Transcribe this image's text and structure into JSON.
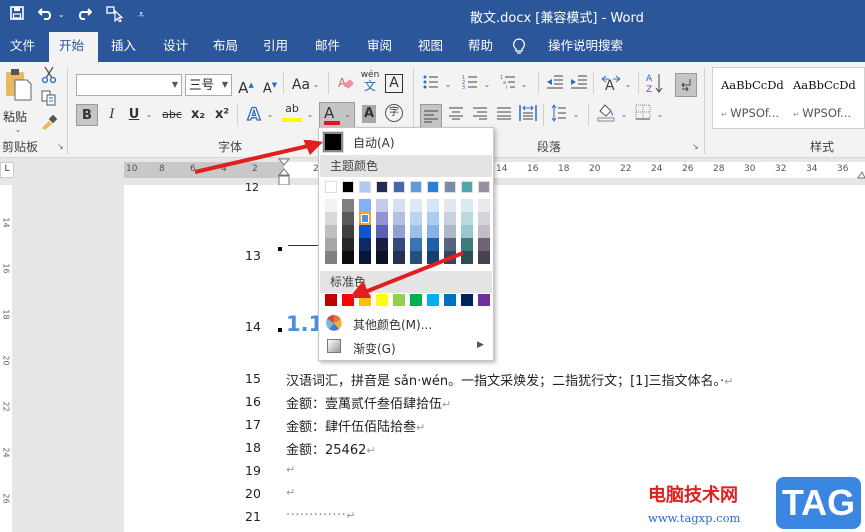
{
  "window": {
    "title": "散文.docx [兼容模式]  -  Word",
    "quick_access": {
      "save_icon": "💾",
      "undo_icon": "↶",
      "redo_icon": "↷",
      "touch_icon": "☞",
      "customize_icon": "⩡"
    }
  },
  "tabs": [
    {
      "label": "文件"
    },
    {
      "label": "开始",
      "active": true
    },
    {
      "label": "插入"
    },
    {
      "label": "设计"
    },
    {
      "label": "布局"
    },
    {
      "label": "引用"
    },
    {
      "label": "邮件"
    },
    {
      "label": "审阅"
    },
    {
      "label": "视图"
    },
    {
      "label": "帮助"
    },
    {
      "label": "操作说明搜索"
    }
  ],
  "ribbon": {
    "clipboard": {
      "paste_label": "粘贴",
      "group_label": "剪贴板"
    },
    "font": {
      "font_name": "",
      "font_size": "三号",
      "grow": "A",
      "shrink": "A",
      "case": "Aa",
      "phonetic_top": "wén",
      "phonetic_bottom": "文",
      "border_char": "A",
      "bold": "B",
      "italic": "I",
      "underline": "U",
      "strike": "abc",
      "subscript": "x₂",
      "superscript": "x²",
      "effects": "A",
      "highlight": "ab",
      "font_color": "A",
      "shade_char": "A",
      "enclose_char": "字",
      "group_label": "字体",
      "font_color_hex": "#e81123",
      "highlight_hex": "#ffff00"
    },
    "paragraph": {
      "group_label": "段落"
    },
    "styles": {
      "items": [
        {
          "preview": "AaBbCcDd",
          "name": "WPSOf..."
        },
        {
          "preview": "AaBbCcDd",
          "name": "WPSOf..."
        }
      ],
      "group_label": "样式"
    }
  },
  "ruler": {
    "left_numbers": [
      "10",
      "8",
      "6",
      "4",
      "2"
    ],
    "right_numbers": [
      "2",
      "14",
      "16",
      "18",
      "20",
      "22",
      "24",
      "26",
      "28",
      "30",
      "32",
      "34",
      "36"
    ],
    "vertical_numbers": [
      "14",
      "16",
      "18",
      "20",
      "22",
      "24",
      "26"
    ],
    "tab_selector": "L"
  },
  "document": {
    "lines": [
      {
        "num": "12",
        "text": ""
      },
      {
        "num": "13",
        "text": "—"
      },
      {
        "num": "14",
        "text": "1.1"
      },
      {
        "num": "15",
        "text": "汉语词汇，拼音是 sǎn·wén。一指文采焕发；二指犹行文；[1]三指文体名。·"
      },
      {
        "num": "16",
        "text": "金额：壹萬贰仟叁佰肆拾伍"
      },
      {
        "num": "17",
        "text": "金额：肆仟伍佰陆拾叁"
      },
      {
        "num": "18",
        "text": "金额：25462"
      },
      {
        "num": "19",
        "text": ""
      },
      {
        "num": "20",
        "text": ""
      },
      {
        "num": "21",
        "text": "·············"
      }
    ],
    "paragraph_mark": "↵"
  },
  "color_menu": {
    "automatic_label": "自动(A)",
    "theme_header": "主题颜色",
    "standard_header": "标准色",
    "more_colors_label": "其他颜色(M)...",
    "gradient_label": "渐变(G)",
    "theme_top_row": [
      "#ffffff",
      "#000000",
      "#aecbf4",
      "#232a55",
      "#4a67ad",
      "#5e9fd8",
      "#2b7fd8",
      "#7b8ba8",
      "#52a3aa",
      "#9a8fa0"
    ],
    "theme_shades": [
      [
        "#f2f2f2",
        "#d9d9d9",
        "#bfbfbf",
        "#a6a6a6",
        "#808080"
      ],
      [
        "#7f7f7f",
        "#595959",
        "#3f3f3f",
        "#262626",
        "#0d0d0d"
      ],
      [
        "#82b0f5",
        "#4e8ef0",
        "#1155cc",
        "#0b2a66",
        "#06163a"
      ],
      [
        "#c7c9e8",
        "#8f94d0",
        "#5860b8",
        "#1a1d40",
        "#0e1026"
      ],
      [
        "#d9dff0",
        "#b3c0e0",
        "#8ea1d1",
        "#35497f",
        "#233153"
      ],
      [
        "#dce9f6",
        "#bcd4ee",
        "#9bbfe6",
        "#3975b5",
        "#255079"
      ],
      [
        "#d5e6f8",
        "#abcdf2",
        "#82b4eb",
        "#1f5fa5",
        "#143f6e"
      ],
      [
        "#e4e7ee",
        "#cad0dd",
        "#afb8cb",
        "#56657f",
        "#394455"
      ],
      [
        "#dcecee",
        "#badade",
        "#97c8cd",
        "#3e7a80",
        "#294f55"
      ],
      [
        "#ebe9ed",
        "#d7d3da",
        "#c2bcc6",
        "#6e6178",
        "#4a414f"
      ]
    ],
    "selected_swatch": {
      "column": 2,
      "row": 1
    },
    "standard_colors": [
      "#c00000",
      "#ff0000",
      "#ffc000",
      "#ffff00",
      "#92d050",
      "#00b050",
      "#00b0f0",
      "#0070c0",
      "#002060",
      "#7030a0"
    ]
  },
  "watermark": {
    "site_name": "电脑技术网",
    "url": "www.tagxp.com",
    "badge": "TAG"
  }
}
